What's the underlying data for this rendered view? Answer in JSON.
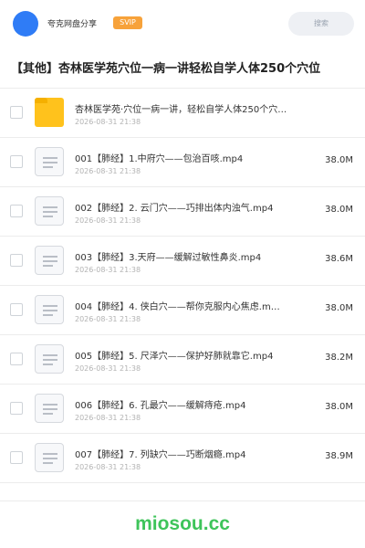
{
  "header": {
    "share_title": "夸克网盘分享",
    "svip_badge": "SVIP",
    "search_placeholder": "搜索"
  },
  "folder_title": "【其他】杏林医学苑穴位一病一讲轻松自学人体250个穴位",
  "files": [
    {
      "type": "folder",
      "name": "杏林医学苑·穴位一病一讲，轻松自学人体250个穴…",
      "date": "2026-08-31 21:38",
      "size": ""
    },
    {
      "type": "file",
      "name": "001【肺经】1.中府穴——包治百咳.mp4",
      "date": "2026-08-31 21:38",
      "size": "38.0M"
    },
    {
      "type": "file",
      "name": "002【肺经】2. 云门穴——巧排出体内浊气.mp4",
      "date": "2026-08-31 21:38",
      "size": "38.0M"
    },
    {
      "type": "file",
      "name": "003【肺经】3.天府——缓解过敏性鼻炎.mp4",
      "date": "2026-08-31 21:38",
      "size": "38.6M"
    },
    {
      "type": "file",
      "name": "004【肺经】4. 侠白穴——帮你克服内心焦虑.m…",
      "date": "2026-08-31 21:38",
      "size": "38.0M"
    },
    {
      "type": "file",
      "name": "005【肺经】5. 尺泽穴——保护好肺就靠它.mp4",
      "date": "2026-08-31 21:38",
      "size": "38.2M"
    },
    {
      "type": "file",
      "name": "006【肺经】6. 孔最穴——缓解痔疮.mp4",
      "date": "2026-08-31 21:38",
      "size": "38.0M"
    },
    {
      "type": "file",
      "name": "007【肺经】7. 列缺穴——巧断烟瘾.mp4",
      "date": "2026-08-31 21:38",
      "size": "38.9M"
    }
  ],
  "watermark": "miosou.cc",
  "colors": {
    "accent": "#2f7cf6",
    "svip": "#f7a23a",
    "folder": "#ffc21c",
    "watermark": "#3ec45a"
  }
}
